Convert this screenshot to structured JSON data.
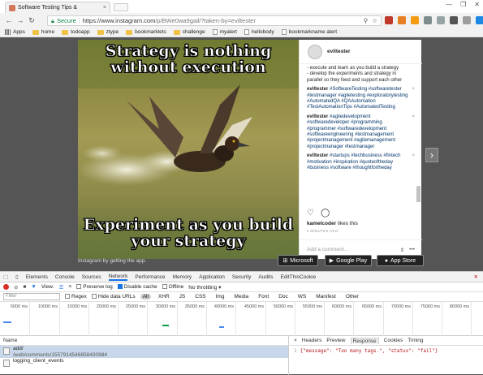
{
  "browser": {
    "tab_title": "Software Testing Tips &",
    "tab_close": "×",
    "window_controls": [
      "—",
      "❐",
      "✕"
    ],
    "secure_label": "Secure",
    "url_base": "https://www.instagram.com",
    "url_path": "/p/BWe0wa9gail/?taken-by=eviltester",
    "bookmarks": [
      "Apps",
      "home",
      "todoapp",
      "ztype",
      "bookmarklets",
      "challenge",
      "myalert",
      "hellobody",
      "bookmarkname alert"
    ],
    "extension_colors": [
      "#c0392b",
      "#e67e22",
      "#f39c12",
      "#7f8c8d",
      "#95a5a6",
      "#555555",
      "#9e9e9e",
      "#1e88e5"
    ]
  },
  "post": {
    "caption_top": [
      "Strategy is nothing",
      "without execution"
    ],
    "caption_bottom": [
      "Experiment as you build",
      "your strategy"
    ],
    "username": "eviltester",
    "caption_text": "- execute and learn as you build a strategy\n- develop the experiments and strategy in parallel so they feed and support each other",
    "comments": [
      {
        "user": "eviltester",
        "hashtags": "#SoftwareTesting #softwaretester #testmanager #agiletesting #exploratorytesting #AutomatedQA #QAAutomation #TestAutomationTips #AutomatedTesting"
      },
      {
        "user": "eviltester",
        "hashtags": "#agiledevelopment #softwaredeveloper #programming #programmer #softwaredevelopment #softwareengineering #testmanagement #projectmanagement #agilemanagement #projectmanager #testmanager"
      },
      {
        "user": "eviltester",
        "hashtags": "#startups #techbusiness #fintech #motivation #inspiration #quoteoftheday #business #software #thoughtfortheday"
      }
    ],
    "comment_close": "×",
    "likes_user": "kamelcoder",
    "likes_suffix": " likes this",
    "time_ago": "2 MINUTES AGO",
    "comment_placeholder": "Add a comment...",
    "next_arrow": "›"
  },
  "signup": {
    "text": "Instagram by getting the app.",
    "stores": [
      "Microsoft",
      "Google Play",
      "App Store"
    ]
  },
  "devtools": {
    "tabs": [
      "Elements",
      "Console",
      "Sources",
      "Network",
      "Performance",
      "Memory",
      "Application",
      "Security",
      "Audits",
      "EditThisCookie"
    ],
    "active_tab": "Network",
    "toolbar": {
      "view_label": "View:",
      "preserve_log": "Preserve log",
      "disable_cache": "Disable cache",
      "offline": "Offline",
      "throttling": "No throttling"
    },
    "filter": {
      "placeholder": "Filter",
      "regex": "Regex",
      "hide_data_urls": "Hide data URLs",
      "types": [
        "All",
        "XHR",
        "JS",
        "CSS",
        "Img",
        "Media",
        "Font",
        "Doc",
        "WS",
        "Manifest",
        "Other"
      ]
    },
    "timeline_ticks": [
      "5000 ms",
      "10000 ms",
      "15000 ms",
      "20000 ms",
      "25000 ms",
      "30000 ms",
      "35000 ms",
      "40000 ms",
      "45000 ms",
      "50000 ms",
      "55000 ms",
      "60000 ms",
      "65000 ms",
      "70000 ms",
      "75000 ms",
      "80000 ms"
    ],
    "requests_header": "Name",
    "requests": [
      {
        "name": "add/",
        "path": "/web/comments/1557914546858430984",
        "selected": true
      },
      {
        "name": "logging_client_events",
        "path": "",
        "selected": false
      }
    ],
    "detail_close": "×",
    "detail_tabs": [
      "Headers",
      "Preview",
      "Response",
      "Cookies",
      "Timing"
    ],
    "detail_active": "Response",
    "response_line": "1",
    "response_body": "{\"message\": \"Too many tags.\", \"status\": \"fail\"}"
  }
}
